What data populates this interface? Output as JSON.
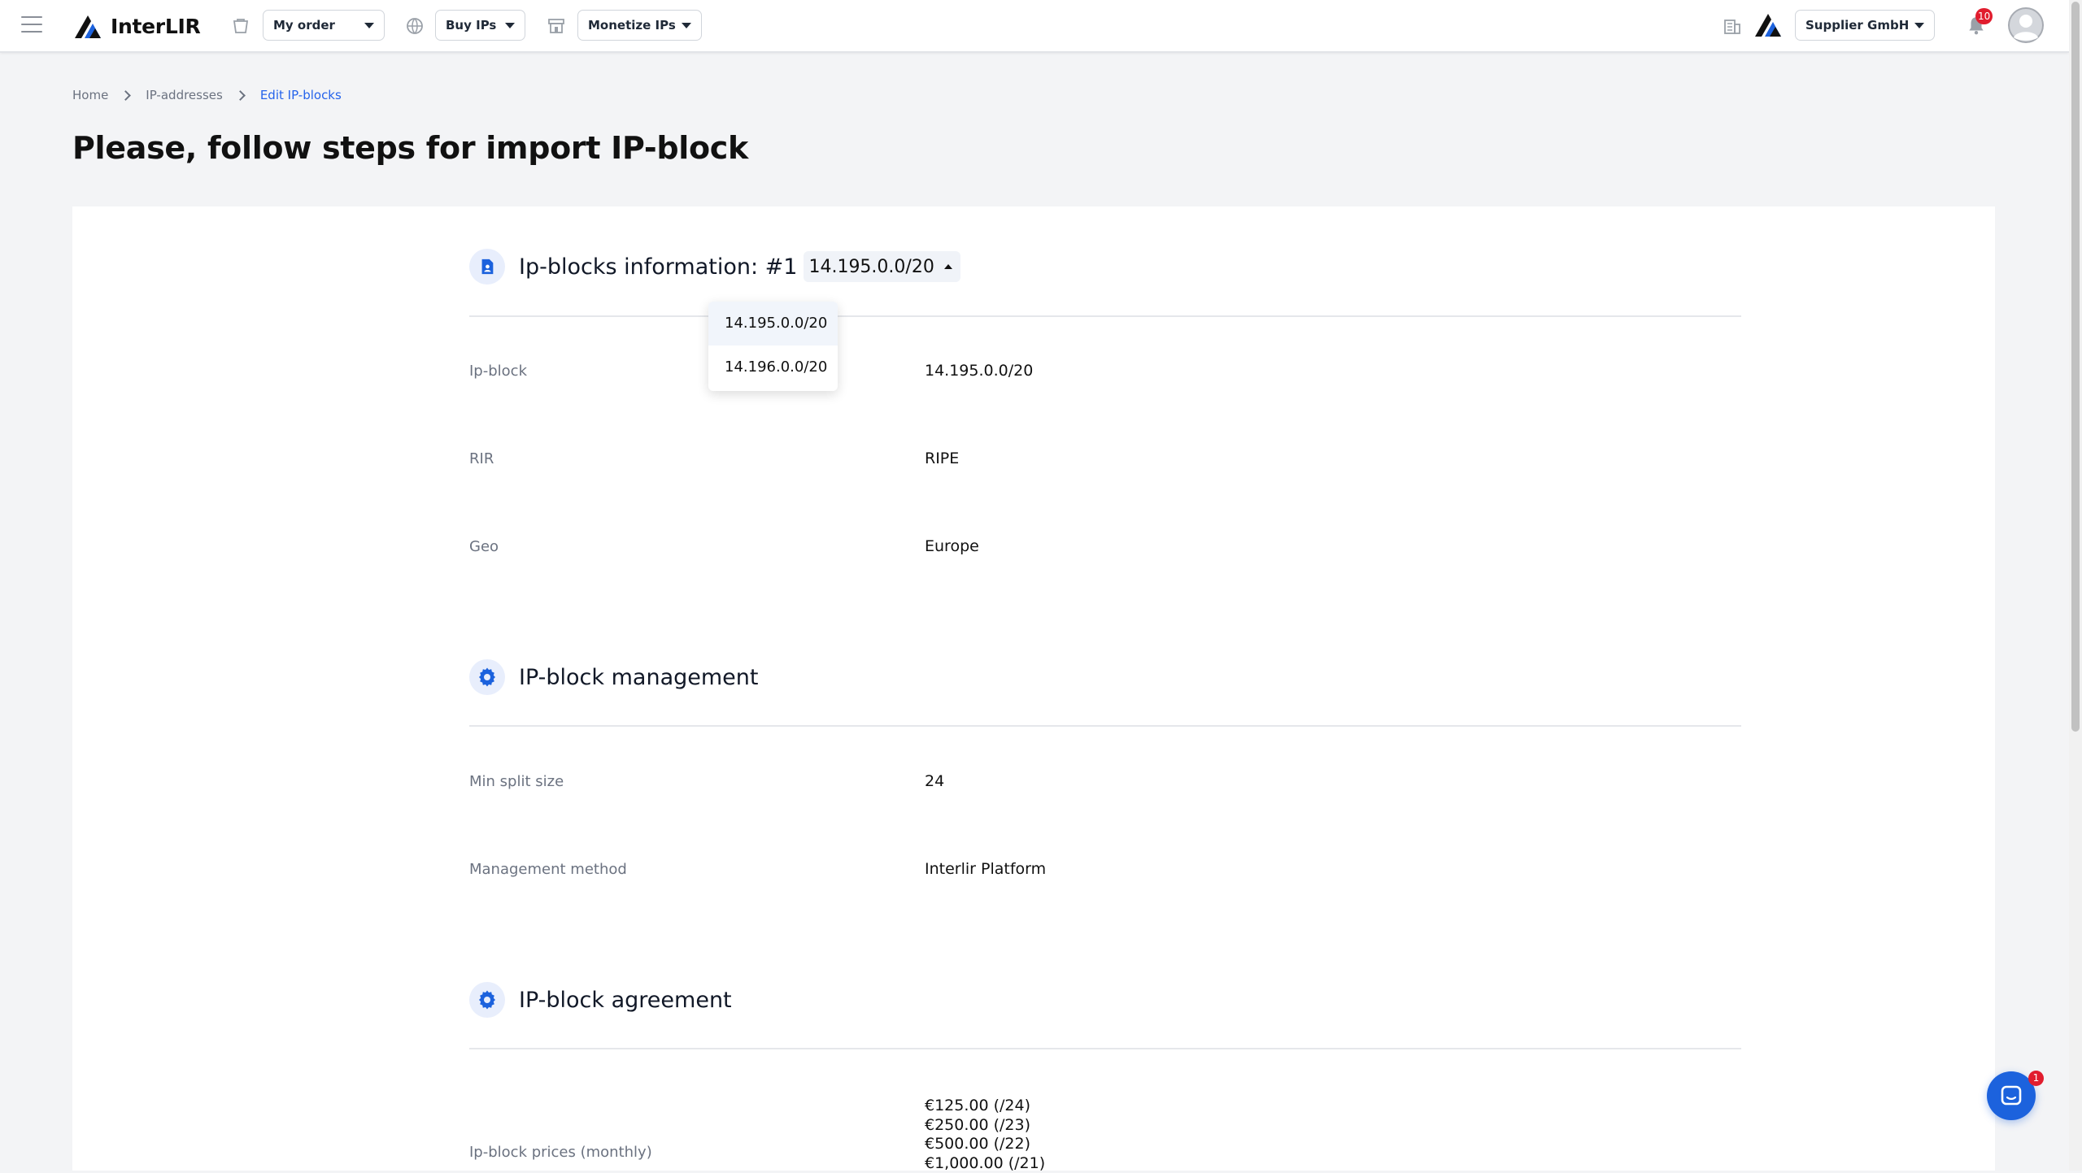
{
  "topbar": {
    "brand": "InterLIR",
    "order_dropdown": "My order",
    "buy_dropdown": "Buy IPs",
    "monetize_dropdown": "Monetize IPs",
    "company_dropdown": "Supplier GmbH",
    "notifications_count": "10"
  },
  "breadcrumb": {
    "home": "Home",
    "ip_addresses": "IP-addresses",
    "current": "Edit IP-blocks"
  },
  "page": {
    "title": "Please, follow steps for import IP-block"
  },
  "section_info": {
    "title": "Ip-blocks information: #1",
    "selected_block": "14.195.0.0/20",
    "options": [
      "14.195.0.0/20",
      "14.196.0.0/20"
    ],
    "rows": [
      {
        "label": "Ip-block",
        "value": "14.195.0.0/20"
      },
      {
        "label": "RIR",
        "value": "RIPE"
      },
      {
        "label": "Geo",
        "value": "Europe"
      }
    ]
  },
  "section_management": {
    "title": "IP-block management",
    "rows": [
      {
        "label": "Min split size",
        "value": "24"
      },
      {
        "label": "Management method",
        "value": "Interlir Platform"
      }
    ]
  },
  "section_agreement": {
    "title": "IP-block agreement",
    "prices_label": "Ip-block prices (monthly)",
    "prices": [
      "€125.00 (/24)",
      "€250.00 (/23)",
      "€500.00 (/22)",
      "€1,000.00 (/21)"
    ]
  },
  "chat": {
    "unread": "1"
  },
  "colors": {
    "accent": "#2563eb",
    "chat": "#1c62dd",
    "badge": "#e11d2e"
  },
  "icons": [
    "menu-icon",
    "interlir-logo-icon",
    "cart-icon",
    "globe-icon",
    "store-icon",
    "building-icon",
    "bell-icon",
    "document-user-icon",
    "gear-icon",
    "chat-icon"
  ]
}
